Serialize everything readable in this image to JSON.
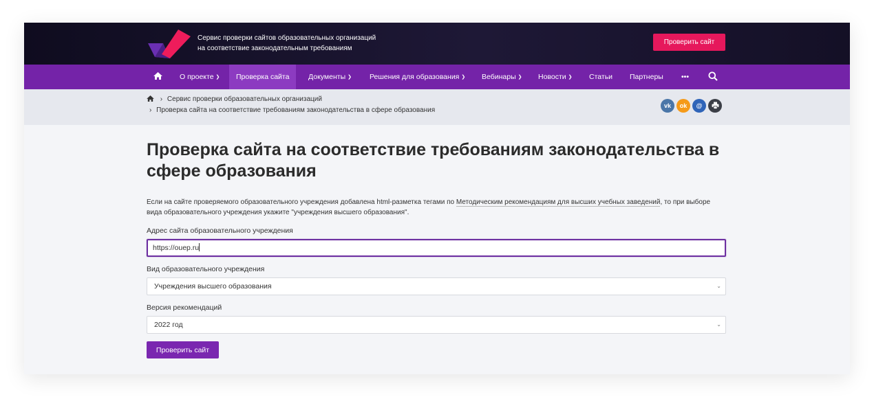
{
  "header": {
    "tagline_line1": "Сервис проверки сайтов образовательных организаций",
    "tagline_line2": "на соответствие законодательным требованиям",
    "cta_label": "Проверить сайт"
  },
  "nav": {
    "items": [
      {
        "label": "О проекте",
        "has_caret": true
      },
      {
        "label": "Проверка сайта",
        "active": true
      },
      {
        "label": "Документы",
        "has_caret": true
      },
      {
        "label": "Решения для образования",
        "has_caret": true
      },
      {
        "label": "Вебинары",
        "has_caret": true
      },
      {
        "label": "Новости",
        "has_caret": true
      },
      {
        "label": "Статьи"
      },
      {
        "label": "Партнеры"
      },
      {
        "label": "•••"
      }
    ]
  },
  "breadcrumb": {
    "item1": "Сервис проверки образовательных организаций",
    "item2": "Проверка сайта на соответствие требованиям законодательства в сфере образования"
  },
  "social": {
    "vk": "vk",
    "ok": "ok",
    "mail": "@",
    "print": "print"
  },
  "page": {
    "title": "Проверка сайта на соответствие требованиям законодательства в сфере образования",
    "intro_before": "Если на сайте проверяемого образовательного учреждения добавлена html-разметка тегами по ",
    "intro_link": "Методическим рекомендациям для высших учебных заведений",
    "intro_after": ", то при выборе вида образовательного учреждения укажите \"учреждения высшего образования\"."
  },
  "form": {
    "url_label": "Адрес сайта образовательного учреждения",
    "url_value": "https://ouep.ru",
    "type_label": "Вид образовательного учреждения",
    "type_value": "Учреждения высшего образования",
    "version_label": "Версия рекомендаций",
    "version_value": "2022 год",
    "submit_label": "Проверить сайт"
  },
  "colors": {
    "header_bg": "#141026",
    "nav_bg": "#7423a8",
    "accent_pink": "#e6185c",
    "submit_purple": "#7a27b0"
  }
}
